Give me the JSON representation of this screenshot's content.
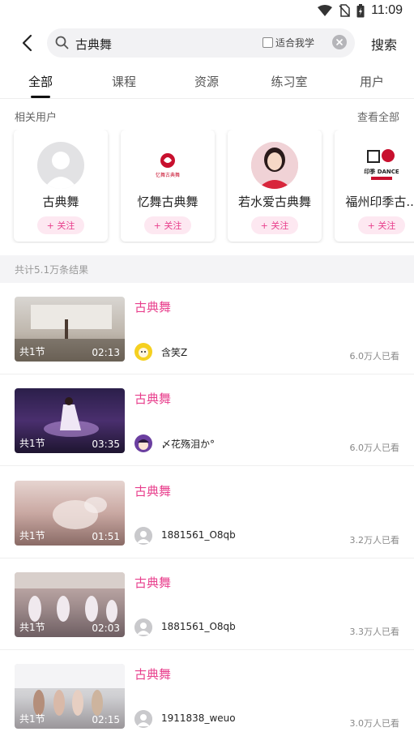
{
  "status": {
    "time": "11:09"
  },
  "search": {
    "query": "古典舞",
    "fit_label": "适合我学",
    "button_label": "搜索"
  },
  "tabs": [
    {
      "label": "全部"
    },
    {
      "label": "课程"
    },
    {
      "label": "资源"
    },
    {
      "label": "练习室"
    },
    {
      "label": "用户"
    }
  ],
  "related_users": {
    "title": "相关用户",
    "see_all": "查看全部",
    "follow_label": "+ 关注",
    "users": [
      {
        "name": "古典舞"
      },
      {
        "name": "忆舞古典舞",
        "logo_text": "忆舞古典舞"
      },
      {
        "name": "若水爱古典舞"
      },
      {
        "name": "福州印季古...",
        "logo_text": "印季 DANCE"
      }
    ]
  },
  "result_count": "共计5.1万条结果",
  "results": [
    {
      "title": "古典舞",
      "lessons": "共1节",
      "duration": "02:13",
      "author": "含笑Z",
      "views": "6.0万人已看"
    },
    {
      "title": "古典舞",
      "lessons": "共1节",
      "duration": "03:35",
      "author": "〆花殇泪か°",
      "views": "6.0万人已看"
    },
    {
      "title": "古典舞",
      "lessons": "共1节",
      "duration": "01:51",
      "author": "1881561_O8qb",
      "views": "3.2万人已看"
    },
    {
      "title": "古典舞",
      "lessons": "共1节",
      "duration": "02:03",
      "author": "1881561_O8qb",
      "views": "3.3万人已看"
    },
    {
      "title": "古典舞",
      "lessons": "共1节",
      "duration": "02:15",
      "author": "1911838_weuo",
      "views": "3.0万人已看"
    }
  ],
  "colors": {
    "accent": "#e83e8c",
    "follow_bg": "#fde8f1"
  }
}
